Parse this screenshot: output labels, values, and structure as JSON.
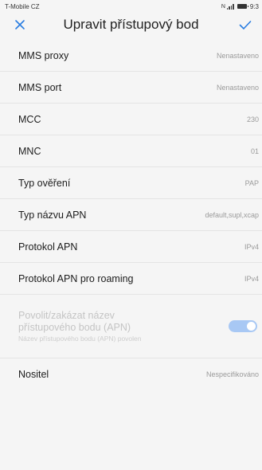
{
  "status_bar": {
    "carrier": "T-Mobile CZ",
    "time": "9:3"
  },
  "header": {
    "title": "Upravit přístupový bod"
  },
  "settings": [
    {
      "label": "MMS proxy",
      "value": "Nenastaveno"
    },
    {
      "label": "MMS port",
      "value": "Nenastaveno"
    },
    {
      "label": "MCC",
      "value": "230"
    },
    {
      "label": "MNC",
      "value": "01"
    },
    {
      "label": "Typ ověření",
      "value": "PAP"
    },
    {
      "label": "Typ názvu APN",
      "value": "default,supl,xcap"
    },
    {
      "label": "Protokol APN",
      "value": "IPv4"
    },
    {
      "label": "Protokol APN pro roaming",
      "value": "IPv4"
    }
  ],
  "apn_toggle": {
    "title": "Povolit/zakázat název přístupového bodu (APN)",
    "subtitle": "Název přístupového bodu (APN) povolen",
    "enabled": true,
    "disabled_style": true
  },
  "bearer": {
    "label": "Nositel",
    "value": "Nespecifikováno"
  },
  "colors": {
    "accent": "#2a7de1",
    "background": "#f5f5f5",
    "switch_on_dimmed": "#a8c8f4"
  }
}
